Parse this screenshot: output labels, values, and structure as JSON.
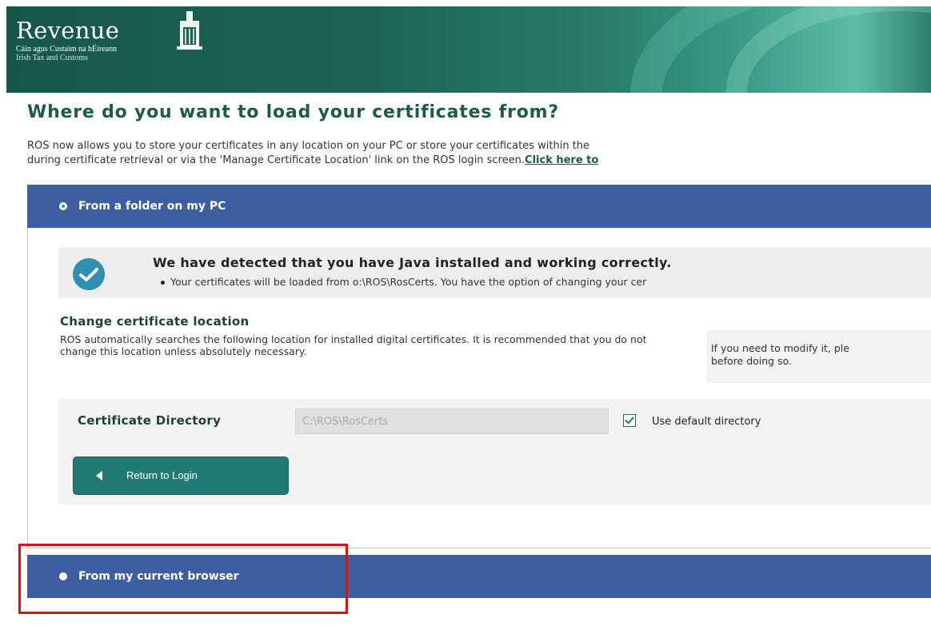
{
  "header": {
    "brand_name": "Revenue",
    "tagline_irish": "Cáin agus Custaim na hÉireann",
    "tagline_english": "Irish Tax and Customs",
    "logo_icon": "harp-icon"
  },
  "page": {
    "title": "Where do you want to load your certificates from?",
    "intro_line1": "ROS now allows you to store your certificates in any location on your PC or store your certificates within the",
    "intro_line2": "during certificate retrieval or via the 'Manage Certificate Location' link on the ROS login screen.",
    "intro_link": "Click here to"
  },
  "options": [
    {
      "label": "From a folder on my PC",
      "selected": true
    },
    {
      "label": "From my current browser",
      "selected": false
    }
  ],
  "notice": {
    "icon": "checkmark-icon",
    "headline": "We have detected that you have Java installed and working correctly.",
    "detail": "Your certificates will be loaded from o:\\ROS\\RosCerts. You have the option of changing your cer"
  },
  "change_location": {
    "heading": "Change certificate location",
    "text": "ROS automatically searches the following location for installed digital certificates. It is recommended that you do not change this location unless absolutely necessary.",
    "hint": "If you need to modify it, ple\nbefore doing so."
  },
  "form": {
    "directory_label": "Certificate Directory",
    "directory_value": "C:\\ROS\\RosCerts",
    "use_default_label": "Use default directory",
    "use_default_checked": true,
    "return_button": "Return to Login"
  },
  "colors": {
    "accent_green": "#1e5a4c",
    "panel_blue": "#3d5ea0",
    "button_teal": "#217b74",
    "highlight_red": "#e01010"
  }
}
